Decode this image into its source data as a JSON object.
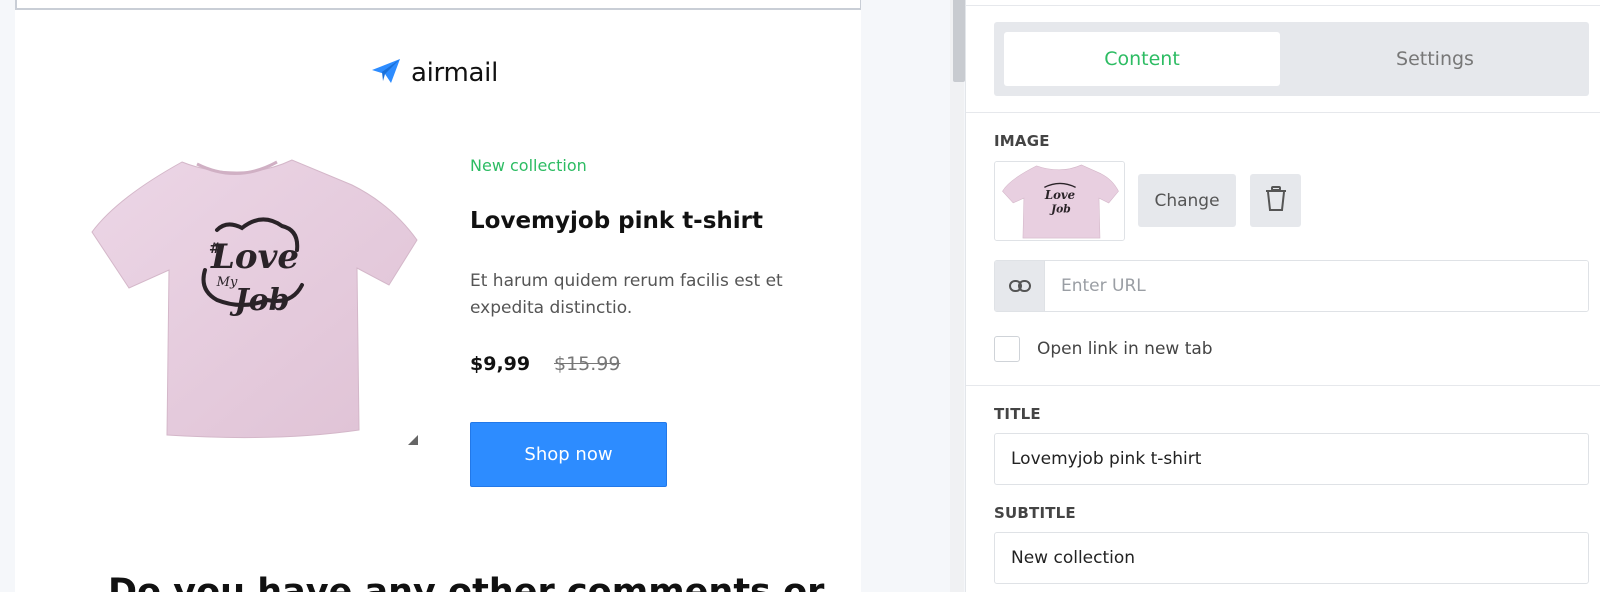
{
  "email": {
    "logo_text": "airmail",
    "product": {
      "subtitle": "New collection",
      "title": "Lovemyjob pink t-shirt",
      "description": "Et harum quidem rerum facilis est et expedita distinctio.",
      "price": "$9,99",
      "old_price": "$15.99",
      "button_label": "Shop now"
    },
    "next_heading": "Do you have any other comments or"
  },
  "panel": {
    "tabs": [
      "Content",
      "Settings"
    ],
    "active_tab": "Content",
    "image_label": "IMAGE",
    "change_label": "Change",
    "url_placeholder": "Enter URL",
    "url_value": "",
    "open_new_tab_label": "Open link in new tab",
    "open_new_tab_checked": false,
    "title_label": "TITLE",
    "title_value": "Lovemyjob pink t-shirt",
    "subtitle_label": "SUBTITLE",
    "subtitle_value": "New collection"
  },
  "icons": {
    "logo": "paper-plane-icon",
    "delete": "trash-icon",
    "link": "link-icon"
  },
  "colors": {
    "accent_green": "#2dbc63",
    "button_blue": "#2d8cff",
    "shirt_pink": "#e8cfe0"
  }
}
